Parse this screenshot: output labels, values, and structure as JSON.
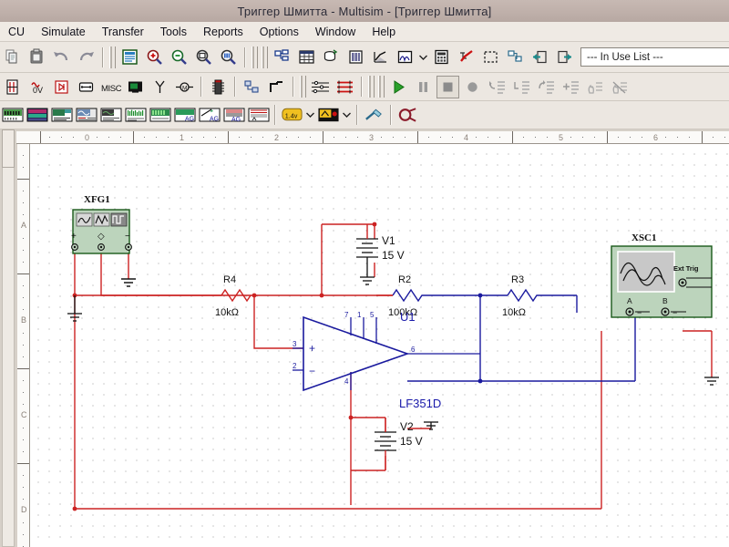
{
  "window": {
    "title": "Триггер Шмитта - Multisim - [Триггер Шмитта]"
  },
  "menu": {
    "items": [
      {
        "label": "CU",
        "name": "menu-mcu"
      },
      {
        "label": "Simulate",
        "name": "menu-simulate"
      },
      {
        "label": "Transfer",
        "name": "menu-transfer"
      },
      {
        "label": "Tools",
        "name": "menu-tools"
      },
      {
        "label": "Reports",
        "name": "menu-reports"
      },
      {
        "label": "Options",
        "name": "menu-options"
      },
      {
        "label": "Window",
        "name": "menu-window"
      },
      {
        "label": "Help",
        "name": "menu-help"
      }
    ]
  },
  "toolbars": {
    "standard": [
      "copy-icon",
      "paste-icon",
      "undo-icon",
      "redo-icon"
    ],
    "view": [
      "full-screen-icon",
      "zoom-in-icon",
      "zoom-out-icon",
      "zoom-area-icon",
      "zoom-fit-icon"
    ],
    "design": [
      "design-toolbox-icon",
      "spreadsheet-view-icon",
      "database-icon",
      "in-use-list-icon",
      "graphs-icon",
      "analysis-icon",
      "postprocessor-icon",
      "erc-icon",
      "capture-area-icon",
      "back-annotate-icon",
      "forward-annotate-icon",
      "export-icon",
      "help-icon",
      "about-icon"
    ],
    "in_use_list": {
      "value": "--- In Use List ---",
      "placeholder": "--- In Use List ---"
    },
    "components": [
      "sources-icon",
      "basic-icon",
      "diodes-icon",
      "transistors-icon",
      "analog-icon",
      "tll-icon",
      "cmos-icon",
      "misc-digital-icon",
      "mixed-icon",
      "indicators-icon",
      "power-icon",
      "misc-icon",
      "advanced-peripherals-icon",
      "rf-icon",
      "electromechanical-icon",
      "mcu-icon",
      "hierarchical-block-icon",
      "bus-icon"
    ],
    "instruments_left": [
      "multimeter-icon",
      "function-generator-icon",
      "wattmeter-icon",
      "oscilloscope-icon",
      "four-channel-oscilloscope-icon",
      "bode-plotter-icon",
      "frequency-counter-icon",
      "word-generator-icon",
      "logic-converter-icon",
      "logic-analyzer-icon",
      "iv-analyzer-icon",
      "distortion-analyzer-icon",
      "spectrum-analyzer-icon",
      "network-analyzer-icon",
      "agilent-function-generator-icon",
      "agilent-multimeter-icon",
      "agilent-oscilloscope-icon",
      "tektronix-oscilloscope-icon"
    ],
    "probes": [
      "measurement-probe-icon",
      "labview-instruments-icon",
      "current-probe-icon",
      "dynamic-probe-icon"
    ],
    "simulation": [
      "run-icon",
      "pause-icon",
      "stop-icon",
      "record-icon",
      "step-into-icon",
      "step-over-icon",
      "step-out-icon",
      "run-to-cursor-icon",
      "toggle-breakpoint-icon",
      "remove-breakpoints-icon"
    ]
  },
  "rulers": {
    "horizontal": [
      "0",
      "1",
      "2",
      "3",
      "4",
      "5",
      "6"
    ],
    "vertical": [
      "A",
      "B",
      "C",
      "D"
    ]
  },
  "schematic": {
    "instruments": [
      {
        "ref": "XFG1",
        "type": "function-generator",
        "terminals": [
          "+",
          "~",
          "-"
        ],
        "waveforms": [
          "sine-wave-icon",
          "triangle-wave-icon",
          "square-wave-icon"
        ]
      },
      {
        "ref": "XSC1",
        "type": "oscilloscope",
        "terminals": [
          "A",
          "B"
        ],
        "ext_trig_label": "Ext Trig"
      }
    ],
    "components": [
      {
        "ref": "R4",
        "value": "10kΩ",
        "type": "resistor"
      },
      {
        "ref": "R2",
        "value": "100kΩ",
        "type": "resistor"
      },
      {
        "ref": "R3",
        "value": "10kΩ",
        "type": "resistor"
      },
      {
        "ref": "V1",
        "value": "15 V",
        "type": "dc-source"
      },
      {
        "ref": "V2",
        "value": "15 V",
        "type": "dc-source"
      },
      {
        "ref": "U1",
        "value": "LF351D",
        "type": "opamp",
        "pins": [
          "7",
          "1",
          "5",
          "2",
          "3",
          "4",
          "6"
        ]
      }
    ],
    "opamp_pin_plus": "+",
    "opamp_pin_minus": "−",
    "colors": {
      "wire_red": "#cc2222",
      "wire_blue": "#1a1a9e",
      "label_blue": "#1a1aaa",
      "instrument_body": "#bcd4bc"
    }
  }
}
